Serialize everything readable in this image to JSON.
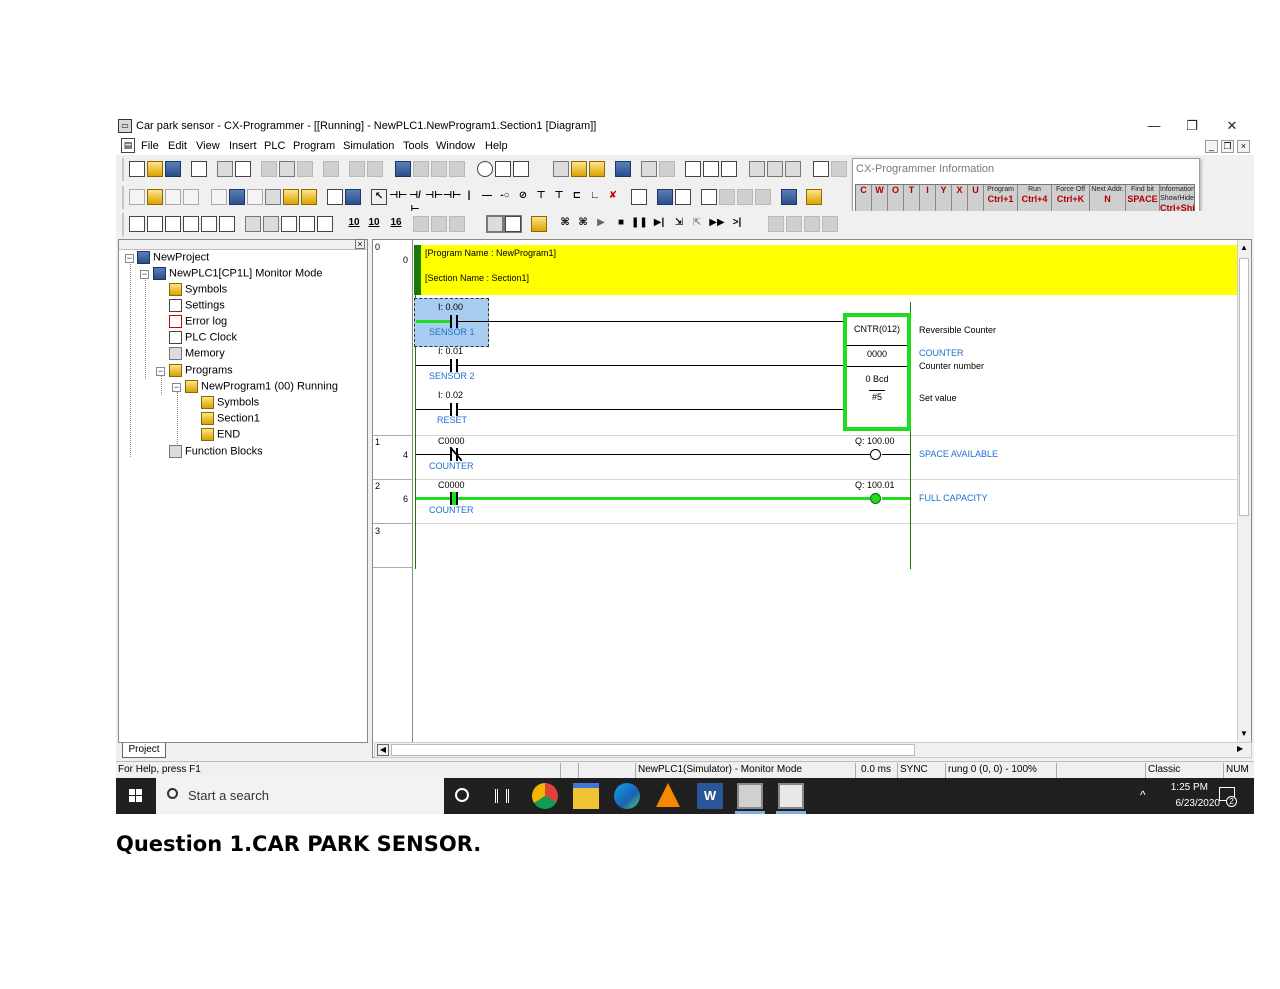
{
  "window": {
    "title": "Car park sensor - CX-Programmer - [[Running] - NewPLC1.NewProgram1.Section1 [Diagram]]",
    "minimize": "—",
    "restore": "❐",
    "close": "✕"
  },
  "menu": {
    "items": [
      "File",
      "Edit",
      "View",
      "Insert",
      "PLC",
      "Program",
      "Simulation",
      "Tools",
      "Window",
      "Help"
    ],
    "mdi_min": "_",
    "mdi_restore": "❐",
    "mdi_close": "×"
  },
  "info_panel": {
    "title": "CX-Programmer Information",
    "cells": [
      {
        "top": "Program",
        "key": "Ctrl+1"
      },
      {
        "top": "Run",
        "key": "Ctrl+4"
      },
      {
        "top": "Force Off",
        "key": "Ctrl+K"
      },
      {
        "top": "Next Addr.",
        "key": "N"
      },
      {
        "top": "Find bit",
        "key": "SPACE"
      },
      {
        "top": "Information Show/Hide",
        "key": "Ctrl+Shift+I"
      }
    ],
    "symbol_keys": [
      "C",
      "W",
      "O",
      "T",
      "I",
      "Y",
      "X",
      "U"
    ]
  },
  "toolbar": {
    "row3_numbers": [
      "10",
      "10",
      "16"
    ]
  },
  "project_tree": {
    "close_label": "×",
    "items": [
      {
        "label": "NewProject",
        "icon": "network-icon"
      },
      {
        "label": "NewPLC1[CP1L] Monitor Mode",
        "icon": "plc-icon"
      },
      {
        "label": "Symbols",
        "icon": "symbols-icon"
      },
      {
        "label": "Settings",
        "icon": "settings-icon"
      },
      {
        "label": "Error log",
        "icon": "error-log-icon"
      },
      {
        "label": "PLC Clock",
        "icon": "clock-icon"
      },
      {
        "label": "Memory",
        "icon": "memory-icon"
      },
      {
        "label": "Programs",
        "icon": "programs-icon"
      },
      {
        "label": "NewProgram1 (00) Running",
        "icon": "program-icon"
      },
      {
        "label": "Symbols",
        "icon": "symbols-icon"
      },
      {
        "label": "Section1",
        "icon": "section-icon"
      },
      {
        "label": "END",
        "icon": "end-icon"
      },
      {
        "label": "Function Blocks",
        "icon": "function-blocks-icon"
      }
    ],
    "tab": "Project"
  },
  "diagram": {
    "rung_numbers": [
      "0",
      "1",
      "2",
      "3"
    ],
    "step_numbers": [
      "0",
      "4",
      "6"
    ],
    "header": {
      "program_name": "[Program Name : NewProgram1]",
      "section_name": "[Section Name : Section1]"
    },
    "rung0": {
      "contacts": [
        {
          "addr": "I: 0.00",
          "name": "SENSOR 1"
        },
        {
          "addr": "I: 0.01",
          "name": "SENSOR 2"
        },
        {
          "addr": "I: 0.02",
          "name": "RESET"
        }
      ],
      "instruction": {
        "name": "CNTR(012)",
        "operand1": "0000",
        "operand2": "0 Bcd",
        "operand3": "#5"
      },
      "comments": {
        "instruction": "Reversible Counter",
        "operand1_symbol": "COUNTER",
        "operand1_desc": "Counter number",
        "operand3_desc": "Set value"
      }
    },
    "rung1": {
      "contact_addr": "C0000",
      "contact_name": "COUNTER",
      "coil_addr": "Q: 100.00",
      "coil_name": "SPACE AVAILABLE"
    },
    "rung2": {
      "contact_addr": "C0000",
      "contact_name": "COUNTER",
      "coil_addr": "Q: 100.01",
      "coil_name": "FULL CAPACITY"
    }
  },
  "statusbar": {
    "help": "For Help, press F1",
    "plc": "NewPLC1(Simulator) - Monitor Mode",
    "scan": "0.0 ms",
    "sync": "SYNC",
    "rung": "rung 0 (0, 0)  - 100%",
    "mode": "Classic",
    "num": "NUM"
  },
  "taskbar": {
    "search_placeholder": "Start a search",
    "time": "1:25 PM",
    "date": "6/23/2020",
    "notification_count": "2"
  },
  "caption": "Question 1.CAR PARK SENSOR."
}
